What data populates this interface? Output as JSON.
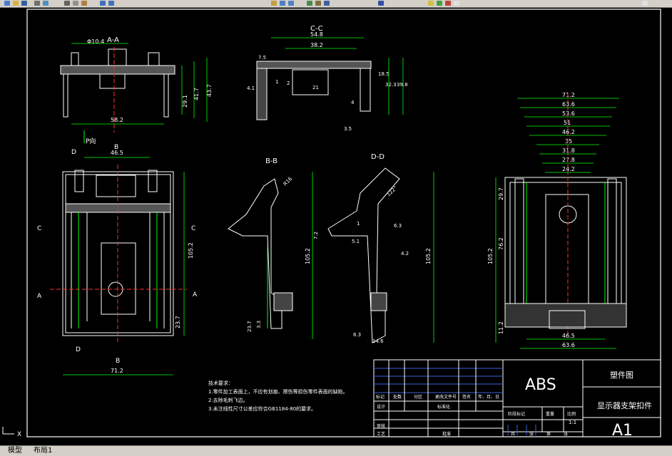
{
  "window": {
    "app": "AutoCAD"
  },
  "layout_tabs": [
    "模型",
    "布局1"
  ],
  "views": {
    "top": {
      "label": "A-A",
      "dims": {
        "dia": "Φ10.4",
        "w": "58.2",
        "h1": "29.1",
        "h2": "41.7",
        "h3": "43.7"
      },
      "p_label": "P向"
    },
    "cc": {
      "label": "C-C",
      "dims": {
        "a": "54.8",
        "b": "38.2",
        "c": "7.5",
        "d": "4.1",
        "e": "1",
        "f": "2",
        "g": "21",
        "h": "18.5",
        "i": "32.3",
        "j": "39.8",
        "k": "4",
        "l": "3.5"
      }
    },
    "front": {
      "dims": {
        "w_top": "46.5",
        "h": "105.2",
        "h_low": "23.7",
        "w_bot": "71.2"
      },
      "markers": {
        "D": "D",
        "B": "B",
        "C": "C",
        "A": "A"
      }
    },
    "bb": {
      "label": "B-B",
      "dims": {
        "r": "R16",
        "h": "105.2",
        "a": "7.2",
        "b": "23.7",
        "c": "3.3"
      }
    },
    "dd": {
      "label": "D-D",
      "dims": {
        "ang": "122°",
        "h": "105.2",
        "a": "1",
        "b": "6.3",
        "c": "5.1",
        "d": "4.2",
        "e": "6.3",
        "f": "14.6"
      }
    },
    "side": {
      "dims": [
        "71.2",
        "63.6",
        "53.6",
        "51",
        "46.2",
        "35",
        "31.8",
        "27.8",
        "24.2"
      ],
      "h1": "29.7",
      "h2": "76.2",
      "h3": "105.2",
      "h4": "11.2",
      "bot1": "46.5",
      "bot2": "63.6"
    }
  },
  "notes": {
    "title": "技术要求：",
    "lines": [
      "1.零件加工表面上，不应有划痕、擦伤等损伤零件表面的缺陷。",
      "2.去除毛刺飞边。",
      "3.未注线性尺寸公差应符合GB1184-80的要求。"
    ]
  },
  "title_block": {
    "material": "ABS",
    "type": "塑件图",
    "name": "显示器支架扣件",
    "sheet": "A1",
    "scale": "1:1",
    "headers": [
      "标记",
      "处数",
      "分区",
      "更改文件号",
      "签名",
      "年、月、日"
    ],
    "labels": {
      "designer": "设计",
      "standard": "标准化",
      "stage": "阶段标记",
      "weight": "重量",
      "ratio": "比例",
      "review": "审核",
      "process": "工艺",
      "approve": "批准",
      "total": "共",
      "page": "张",
      "num": "第",
      "page2": "张"
    }
  }
}
